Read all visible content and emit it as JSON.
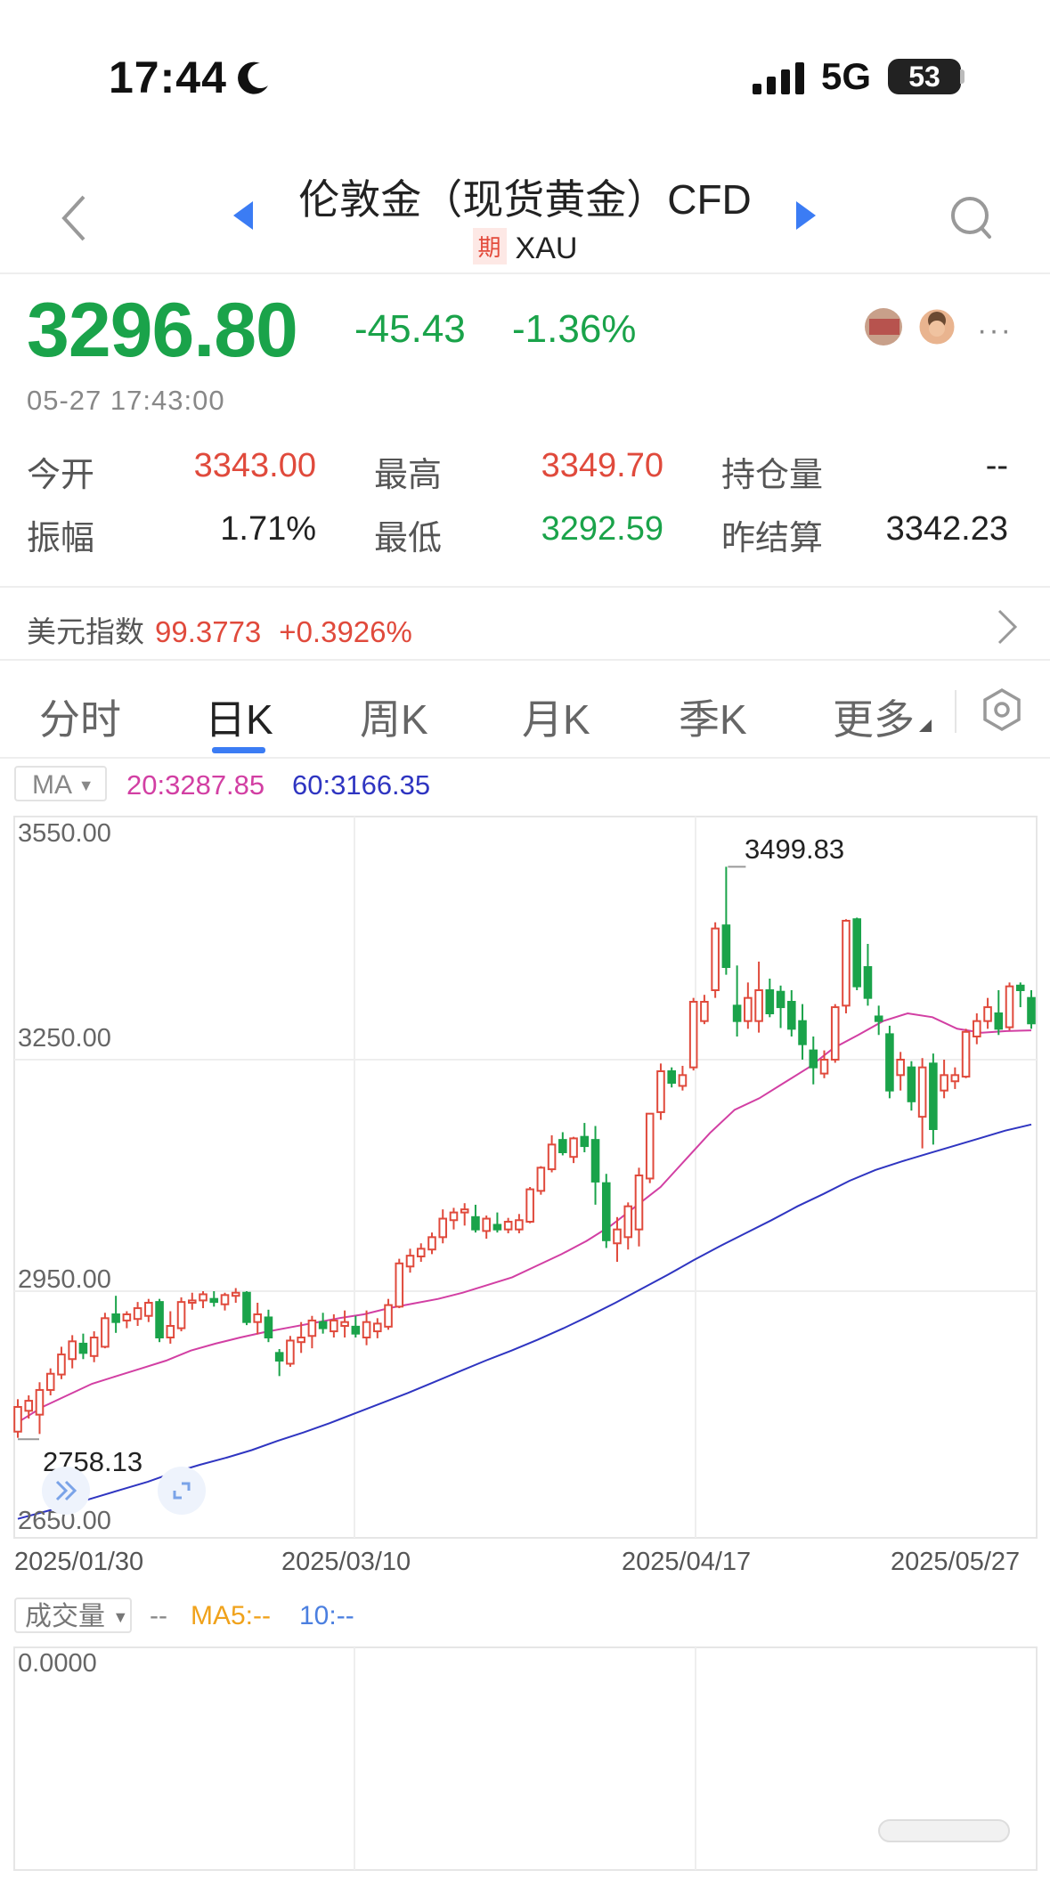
{
  "status": {
    "time": "17:44",
    "network": "5G",
    "battery": "53"
  },
  "header": {
    "title": "伦敦金（现货黄金）CFD",
    "tag": "期",
    "symbol": "XAU"
  },
  "quote": {
    "price": "3296.80",
    "change": "-45.43",
    "change_pct": "-1.36%",
    "timestamp": "05-27 17:43:00",
    "more": "···",
    "stats": [
      {
        "label": "今开",
        "value": "3343.00",
        "color": "red"
      },
      {
        "label": "最高",
        "value": "3349.70",
        "color": "red"
      },
      {
        "label": "持仓量",
        "value": "--",
        "color": "dark"
      },
      {
        "label": "振幅",
        "value": "1.71%",
        "color": "dark"
      },
      {
        "label": "最低",
        "value": "3292.59",
        "color": "green"
      },
      {
        "label": "昨结算",
        "value": "3342.23",
        "color": "dark"
      }
    ]
  },
  "usd_index": {
    "label": "美元指数",
    "value": "99.3773",
    "change": "+0.3926%"
  },
  "tabs": [
    {
      "label": "分时"
    },
    {
      "label": "日K"
    },
    {
      "label": "周K"
    },
    {
      "label": "月K"
    },
    {
      "label": "季K"
    },
    {
      "label": "更多"
    }
  ],
  "active_tab": 1,
  "ma_bar": {
    "selector": "MA",
    "ma20": "20:3287.85",
    "ma60": "60:3166.35"
  },
  "volume_bar": {
    "selector": "成交量",
    "dash": "--",
    "ma5": "MA5:--",
    "ma10": "10:--",
    "axis": "0.0000"
  },
  "colors": {
    "up": "#e04a3c",
    "down": "#1aa34a",
    "ma20": "#d23fa3",
    "ma60": "#2f35c1",
    "accent": "#3b7cf4"
  },
  "chart_data": {
    "type": "candlestick",
    "title": "日K",
    "ylim": [
      2650,
      3550
    ],
    "y_ticks": [
      "3550.00",
      "3250.00",
      "2950.00",
      "2650.00"
    ],
    "x_ticks": [
      "2025/01/30",
      "2025/03/10",
      "2025/04/17",
      "2025/05/27"
    ],
    "annotations": {
      "high": "3499.83",
      "low": "2758.13"
    },
    "candles": [
      {
        "o": 2768,
        "h": 2810,
        "l": 2760,
        "c": 2800
      },
      {
        "o": 2795,
        "h": 2815,
        "l": 2785,
        "c": 2808
      },
      {
        "o": 2790,
        "h": 2832,
        "l": 2765,
        "c": 2822
      },
      {
        "o": 2822,
        "h": 2850,
        "l": 2815,
        "c": 2843
      },
      {
        "o": 2842,
        "h": 2878,
        "l": 2836,
        "c": 2868
      },
      {
        "o": 2862,
        "h": 2893,
        "l": 2850,
        "c": 2885
      },
      {
        "o": 2882,
        "h": 2895,
        "l": 2862,
        "c": 2870
      },
      {
        "o": 2866,
        "h": 2898,
        "l": 2858,
        "c": 2890
      },
      {
        "o": 2878,
        "h": 2922,
        "l": 2876,
        "c": 2915
      },
      {
        "o": 2920,
        "h": 2944,
        "l": 2896,
        "c": 2910
      },
      {
        "o": 2912,
        "h": 2924,
        "l": 2902,
        "c": 2920
      },
      {
        "o": 2914,
        "h": 2936,
        "l": 2905,
        "c": 2928
      },
      {
        "o": 2918,
        "h": 2940,
        "l": 2910,
        "c": 2935
      },
      {
        "o": 2936,
        "h": 2940,
        "l": 2884,
        "c": 2890
      },
      {
        "o": 2890,
        "h": 2924,
        "l": 2882,
        "c": 2905
      },
      {
        "o": 2902,
        "h": 2942,
        "l": 2898,
        "c": 2936
      },
      {
        "o": 2935,
        "h": 2948,
        "l": 2926,
        "c": 2938
      },
      {
        "o": 2938,
        "h": 2950,
        "l": 2928,
        "c": 2946
      },
      {
        "o": 2940,
        "h": 2950,
        "l": 2930,
        "c": 2936
      },
      {
        "o": 2933,
        "h": 2948,
        "l": 2925,
        "c": 2945
      },
      {
        "o": 2944,
        "h": 2954,
        "l": 2935,
        "c": 2948
      },
      {
        "o": 2948,
        "h": 2950,
        "l": 2906,
        "c": 2910
      },
      {
        "o": 2910,
        "h": 2935,
        "l": 2894,
        "c": 2920
      },
      {
        "o": 2916,
        "h": 2926,
        "l": 2884,
        "c": 2890
      },
      {
        "o": 2870,
        "h": 2875,
        "l": 2840,
        "c": 2860
      },
      {
        "o": 2856,
        "h": 2892,
        "l": 2852,
        "c": 2886
      },
      {
        "o": 2884,
        "h": 2910,
        "l": 2870,
        "c": 2890
      },
      {
        "o": 2892,
        "h": 2918,
        "l": 2876,
        "c": 2912
      },
      {
        "o": 2910,
        "h": 2922,
        "l": 2895,
        "c": 2902
      },
      {
        "o": 2898,
        "h": 2920,
        "l": 2890,
        "c": 2912
      },
      {
        "o": 2905,
        "h": 2925,
        "l": 2890,
        "c": 2910
      },
      {
        "o": 2904,
        "h": 2918,
        "l": 2890,
        "c": 2895
      },
      {
        "o": 2890,
        "h": 2925,
        "l": 2880,
        "c": 2910
      },
      {
        "o": 2898,
        "h": 2915,
        "l": 2889,
        "c": 2908
      },
      {
        "o": 2904,
        "h": 2940,
        "l": 2900,
        "c": 2932
      },
      {
        "o": 2930,
        "h": 2992,
        "l": 2928,
        "c": 2986
      },
      {
        "o": 2982,
        "h": 3005,
        "l": 2974,
        "c": 2996
      },
      {
        "o": 2995,
        "h": 3012,
        "l": 2988,
        "c": 3005
      },
      {
        "o": 3004,
        "h": 3026,
        "l": 2998,
        "c": 3020
      },
      {
        "o": 3020,
        "h": 3056,
        "l": 3012,
        "c": 3044
      },
      {
        "o": 3042,
        "h": 3058,
        "l": 3030,
        "c": 3052
      },
      {
        "o": 3052,
        "h": 3064,
        "l": 3035,
        "c": 3056
      },
      {
        "o": 3046,
        "h": 3062,
        "l": 3026,
        "c": 3030
      },
      {
        "o": 3028,
        "h": 3048,
        "l": 3018,
        "c": 3044
      },
      {
        "o": 3036,
        "h": 3052,
        "l": 3026,
        "c": 3030
      },
      {
        "o": 3030,
        "h": 3045,
        "l": 3025,
        "c": 3040
      },
      {
        "o": 3030,
        "h": 3050,
        "l": 3025,
        "c": 3042
      },
      {
        "o": 3040,
        "h": 3085,
        "l": 3038,
        "c": 3082
      },
      {
        "o": 3080,
        "h": 3112,
        "l": 3075,
        "c": 3110
      },
      {
        "o": 3108,
        "h": 3152,
        "l": 3104,
        "c": 3140
      },
      {
        "o": 3146,
        "h": 3156,
        "l": 3126,
        "c": 3130
      },
      {
        "o": 3124,
        "h": 3150,
        "l": 3116,
        "c": 3148
      },
      {
        "o": 3150,
        "h": 3168,
        "l": 3130,
        "c": 3138
      },
      {
        "o": 3146,
        "h": 3164,
        "l": 3062,
        "c": 3092
      },
      {
        "o": 3090,
        "h": 3102,
        "l": 3006,
        "c": 3016
      },
      {
        "o": 3012,
        "h": 3046,
        "l": 2988,
        "c": 3030
      },
      {
        "o": 3020,
        "h": 3065,
        "l": 3004,
        "c": 3060
      },
      {
        "o": 3030,
        "h": 3110,
        "l": 3008,
        "c": 3100
      },
      {
        "o": 3096,
        "h": 3180,
        "l": 3090,
        "c": 3180
      },
      {
        "o": 3182,
        "h": 3245,
        "l": 3172,
        "c": 3235
      },
      {
        "o": 3235,
        "h": 3240,
        "l": 3214,
        "c": 3220
      },
      {
        "o": 3216,
        "h": 3242,
        "l": 3210,
        "c": 3230
      },
      {
        "o": 3240,
        "h": 3330,
        "l": 3236,
        "c": 3325
      },
      {
        "o": 3300,
        "h": 3334,
        "l": 3296,
        "c": 3325
      },
      {
        "o": 3340,
        "h": 3428,
        "l": 3330,
        "c": 3420
      },
      {
        "o": 3424,
        "h": 3500,
        "l": 3360,
        "c": 3370
      },
      {
        "o": 3320,
        "h": 3372,
        "l": 3280,
        "c": 3300
      },
      {
        "o": 3300,
        "h": 3350,
        "l": 3290,
        "c": 3330
      },
      {
        "o": 3300,
        "h": 3377,
        "l": 3285,
        "c": 3340
      },
      {
        "o": 3340,
        "h": 3355,
        "l": 3305,
        "c": 3310
      },
      {
        "o": 3338,
        "h": 3346,
        "l": 3291,
        "c": 3318
      },
      {
        "o": 3325,
        "h": 3340,
        "l": 3280,
        "c": 3290
      },
      {
        "o": 3300,
        "h": 3322,
        "l": 3250,
        "c": 3270
      },
      {
        "o": 3262,
        "h": 3280,
        "l": 3218,
        "c": 3240
      },
      {
        "o": 3232,
        "h": 3262,
        "l": 3226,
        "c": 3250
      },
      {
        "o": 3250,
        "h": 3322,
        "l": 3246,
        "c": 3318
      },
      {
        "o": 3320,
        "h": 3432,
        "l": 3310,
        "c": 3430
      },
      {
        "o": 3432,
        "h": 3434,
        "l": 3340,
        "c": 3345
      },
      {
        "o": 3370,
        "h": 3400,
        "l": 3320,
        "c": 3330
      },
      {
        "o": 3306,
        "h": 3320,
        "l": 3282,
        "c": 3300
      },
      {
        "o": 3283,
        "h": 3294,
        "l": 3200,
        "c": 3210
      },
      {
        "o": 3230,
        "h": 3260,
        "l": 3210,
        "c": 3250
      },
      {
        "o": 3240,
        "h": 3248,
        "l": 3184,
        "c": 3196
      },
      {
        "o": 3176,
        "h": 3252,
        "l": 3135,
        "c": 3240
      },
      {
        "o": 3245,
        "h": 3258,
        "l": 3140,
        "c": 3160
      },
      {
        "o": 3210,
        "h": 3250,
        "l": 3200,
        "c": 3230
      },
      {
        "o": 3222,
        "h": 3240,
        "l": 3212,
        "c": 3230
      },
      {
        "o": 3228,
        "h": 3290,
        "l": 3226,
        "c": 3286
      },
      {
        "o": 3280,
        "h": 3310,
        "l": 3270,
        "c": 3300
      },
      {
        "o": 3300,
        "h": 3330,
        "l": 3290,
        "c": 3318
      },
      {
        "o": 3310,
        "h": 3340,
        "l": 3282,
        "c": 3290
      },
      {
        "o": 3292,
        "h": 3350,
        "l": 3288,
        "c": 3345
      },
      {
        "o": 3346,
        "h": 3350,
        "l": 3318,
        "c": 3340
      },
      {
        "o": 3330,
        "h": 3340,
        "l": 3290,
        "c": 3297
      }
    ],
    "ma20": [
      2780,
      2800,
      2815,
      2830,
      2840,
      2850,
      2860,
      2873,
      2882,
      2890,
      2897,
      2903,
      2909,
      2915,
      2920,
      2928,
      2934,
      2940,
      2948,
      2958,
      2968,
      2983,
      2998,
      3015,
      3035,
      3060,
      3085,
      3120,
      3155,
      3185,
      3200,
      3220,
      3240,
      3265,
      3282,
      3300,
      3310,
      3305,
      3290,
      3285,
      3287,
      3288
    ],
    "ma60": [
      2655,
      2664,
      2673,
      2683,
      2693,
      2703,
      2715,
      2725,
      2734,
      2744,
      2756,
      2767,
      2779,
      2792,
      2805,
      2818,
      2832,
      2846,
      2860,
      2873,
      2887,
      2902,
      2918,
      2935,
      2953,
      2971,
      2990,
      3008,
      3025,
      3042,
      3060,
      3076,
      3093,
      3107,
      3118,
      3128,
      3138,
      3148,
      3158,
      3166
    ]
  }
}
